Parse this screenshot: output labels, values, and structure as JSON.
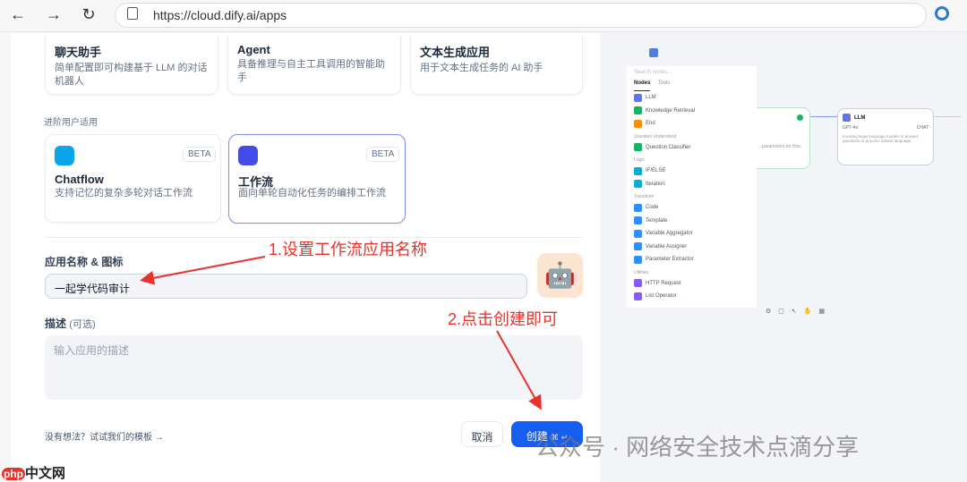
{
  "browser": {
    "url": "https://cloud.dify.ai/apps",
    "back": "←",
    "forward": "→",
    "reload": "↻"
  },
  "basic_cards": [
    {
      "title": "聊天助手",
      "desc": "简单配置即可构建基于 LLM 的对话机器人"
    },
    {
      "title": "Agent",
      "desc": "具备推理与自主工具调用的智能助手"
    },
    {
      "title": "文本生成应用",
      "desc": "用于文本生成任务的 AI 助手"
    }
  ],
  "advanced_label": "进阶用户适用",
  "advanced_cards": [
    {
      "title": "Chatflow",
      "desc": "支持记忆的复杂多轮对话工作流",
      "badge": "BETA"
    },
    {
      "title": "工作流",
      "desc": "面向单轮自动化任务的编排工作流",
      "badge": "BETA"
    }
  ],
  "form": {
    "name_label": "应用名称 & 图标",
    "name_value": "一起学代码审计",
    "desc_label": "描述",
    "desc_optional": "(可选)",
    "desc_placeholder": "输入应用的描述"
  },
  "footer": {
    "template_link": "没有想法？试试我们的模板 →",
    "cancel": "取消",
    "create": "创建",
    "shortcut": "⌘ ↵"
  },
  "annotations": {
    "step1": "1.设置工作流应用名称",
    "step2": "2.点击创建即可"
  },
  "watermark": "公众号 · 网络安全技术点滴分享",
  "logo": "php中文网",
  "preview": {
    "search": "Search nodes...",
    "tabs": [
      "Nodes",
      "Tools"
    ],
    "groups": [
      {
        "title": "",
        "items": [
          [
            "LLM",
            "#6172f3"
          ],
          [
            "Knowledge Retrieval",
            "#16b364"
          ],
          [
            "End",
            "#f79009"
          ]
        ]
      },
      {
        "title": "Question Understand",
        "items": [
          [
            "Question Classifier",
            "#16b364"
          ]
        ]
      },
      {
        "title": "Logic",
        "items": [
          [
            "IF/ELSE",
            "#06aed4"
          ],
          [
            "Iteration",
            "#06aed4"
          ]
        ]
      },
      {
        "title": "Transform",
        "items": [
          [
            "Code",
            "#2e90fa"
          ],
          [
            "Template",
            "#2e90fa"
          ],
          [
            "Variable Aggregator",
            "#2e90fa"
          ],
          [
            "Variable Assigner",
            "#2e90fa"
          ],
          [
            "Parameter Extractor",
            "#2e90fa"
          ]
        ]
      },
      {
        "title": "Utilities",
        "items": [
          [
            "HTTP Request",
            "#875bf7"
          ],
          [
            "List Operator",
            "#875bf7"
          ]
        ]
      }
    ],
    "llm_node": {
      "title": "LLM",
      "model": "GPT-4o",
      "mode": "CHAT",
      "desc": "Invoking large language models to answer questions or process natural language"
    },
    "start_desc": "...parameters for flow"
  },
  "colors": {
    "accent": "#155eef",
    "annotation": "#e8322b"
  }
}
